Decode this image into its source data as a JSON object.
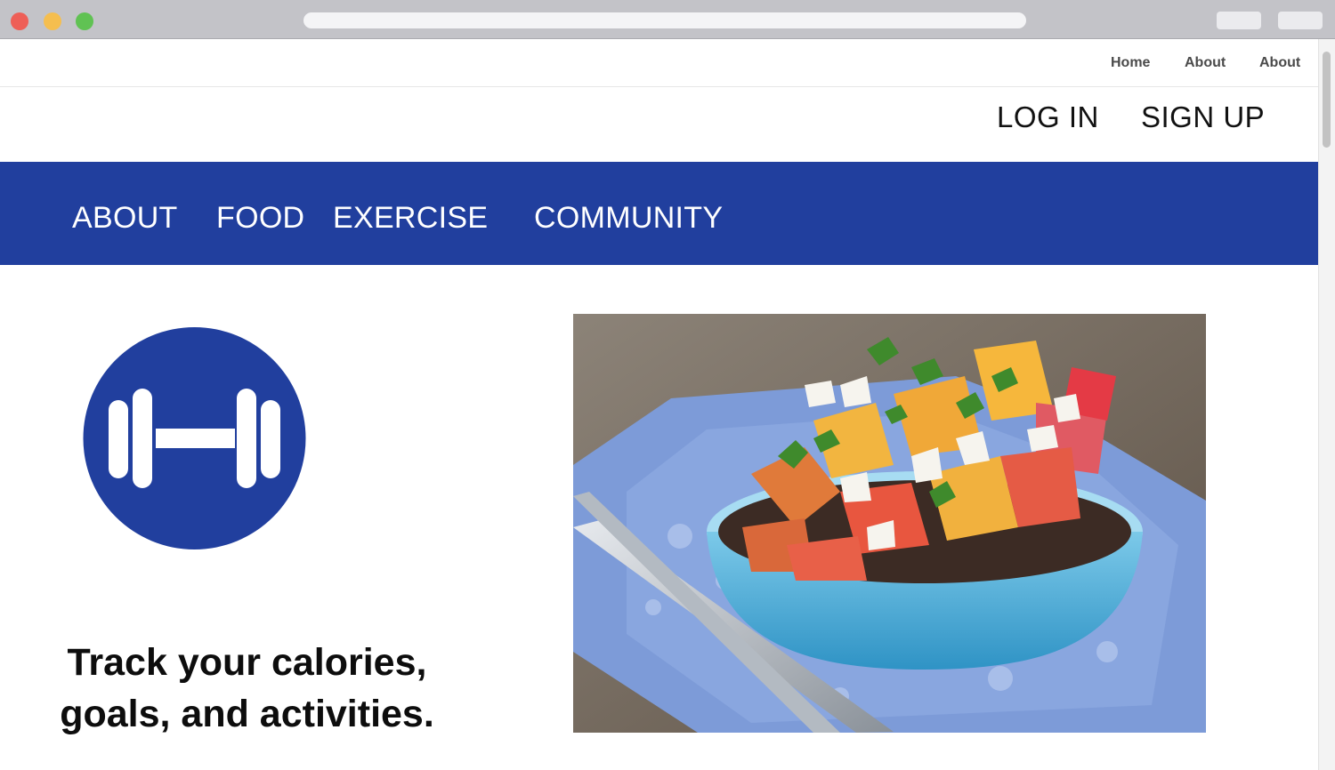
{
  "browser": {
    "url": ""
  },
  "utility_nav": {
    "items": [
      "Home",
      "About",
      "About"
    ]
  },
  "auth": {
    "login_label": "LOG IN",
    "signup_label": "SIGN UP"
  },
  "main_nav": {
    "items": [
      "ABOUT",
      "FOOD",
      "EXERCISE",
      "COMMUNITY"
    ]
  },
  "hero": {
    "tagline_line1": "Track your calories,",
    "tagline_line2": "goals, and activities.",
    "image_subject": "salad bowl with roasted beets, feta and herbs on a blue napkin with a fork"
  },
  "icons": {
    "logo": "dumbbell-icon"
  },
  "colors": {
    "brand_blue": "#213f9e",
    "nav_text": "#ffffff",
    "page_bg": "#ffffff"
  }
}
